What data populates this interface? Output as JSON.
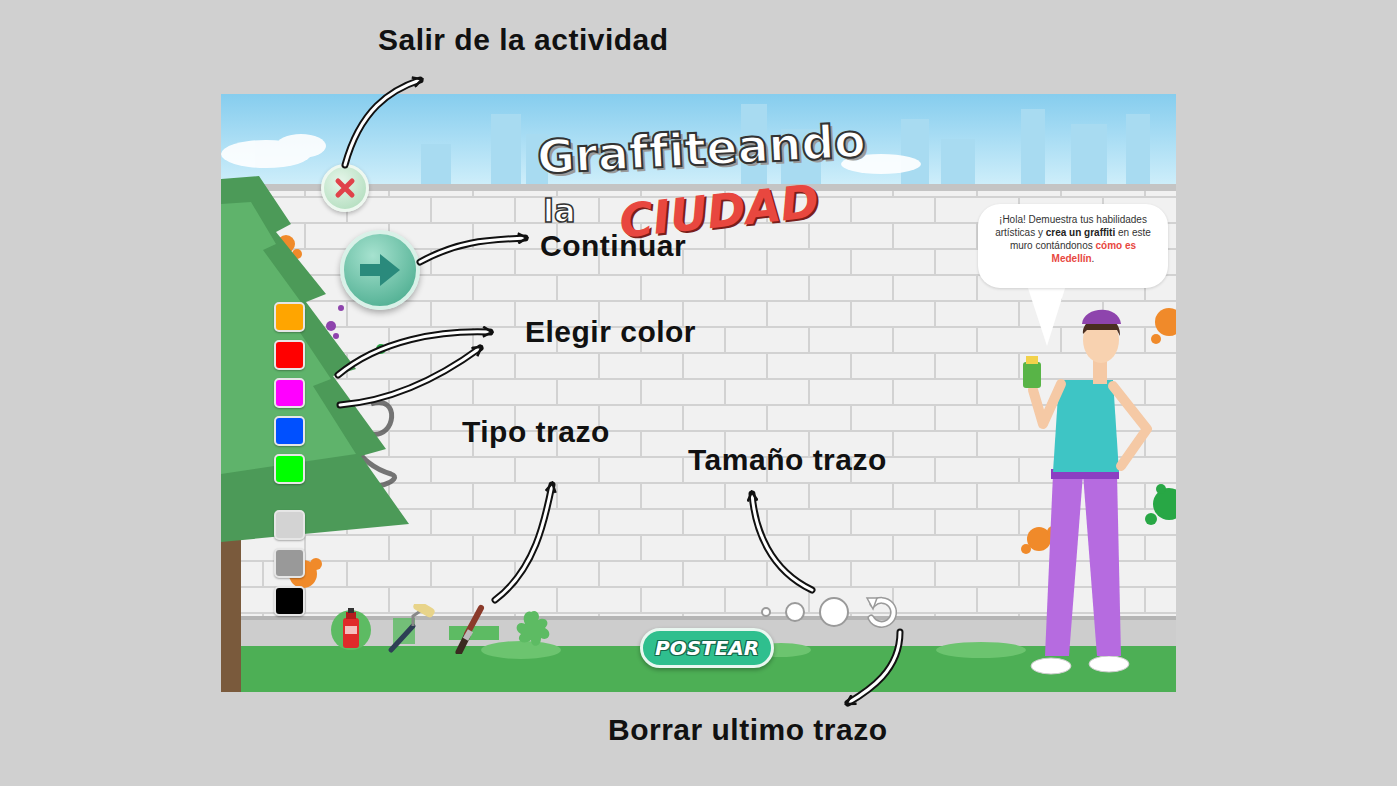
{
  "annotations": [
    {
      "text": "Salir de la actividad"
    },
    {
      "text": "Continuar"
    },
    {
      "text": "Elegir color"
    },
    {
      "text": "Tipo trazo"
    },
    {
      "text": "Tamaño trazo"
    },
    {
      "text": "Borrar ultimo trazo"
    }
  ],
  "game": {
    "title": {
      "line1": "Graffiteando",
      "line2": "la",
      "line3": "CIUDAD"
    },
    "speech": [
      {
        "text": "¡Hola! Demuestra tus habilidades artísticas y ",
        "kind": "plain"
      },
      {
        "text": "crea un graffiti",
        "kind": "bold"
      },
      {
        "text": " en este muro contándonos ",
        "kind": "plain"
      },
      {
        "text": "cómo es Medellín",
        "kind": "highlight"
      },
      {
        "text": ".",
        "kind": "plain"
      }
    ],
    "colors": [
      {
        "color": "#ffa500"
      },
      {
        "color": "#ff0000"
      },
      {
        "color": "#ff00ff"
      },
      {
        "color": "#0050ff"
      },
      {
        "color": "#00ff00"
      },
      {
        "color": "#d3d3d3"
      },
      {
        "color": "#999999"
      },
      {
        "color": "#000000"
      }
    ],
    "tools": [
      {
        "kind": "spray"
      },
      {
        "kind": "roller"
      },
      {
        "kind": "brush"
      },
      {
        "kind": "stamp"
      }
    ],
    "sizes": [
      {
        "kind": "small"
      },
      {
        "kind": "medium"
      },
      {
        "kind": "large"
      }
    ],
    "post_button": "POSTEAR"
  }
}
